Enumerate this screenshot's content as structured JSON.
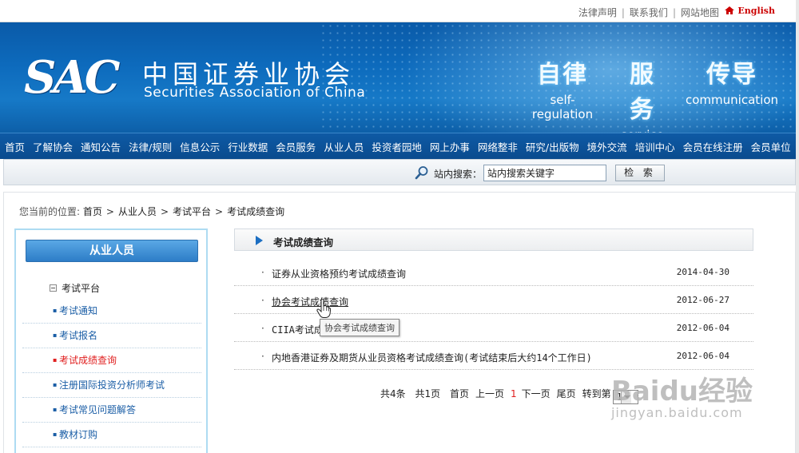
{
  "toplinks": {
    "items": [
      "法律声明",
      "联系我们",
      "网站地图"
    ],
    "english": "English"
  },
  "banner": {
    "logo_mark": "SAC",
    "name_cn": "中国证券业协会",
    "name_en": "Securities Association of China",
    "slogans": [
      {
        "cn": "自律",
        "en": "self-regulation"
      },
      {
        "cn": "服务",
        "en": "service"
      },
      {
        "cn": "传导",
        "en": "communication"
      }
    ]
  },
  "nav": {
    "items": [
      "首页",
      "了解协会",
      "通知公告",
      "法律/规则",
      "信息公示",
      "行业数据",
      "会员服务",
      "从业人员",
      "投资者园地",
      "网上办事",
      "网络整非",
      "研究/出版物",
      "境外交流",
      "培训中心",
      "会员在线注册",
      "会员单位"
    ]
  },
  "search": {
    "label": "站内搜索：",
    "value": "站内搜索关键字",
    "button": "检 索"
  },
  "breadcrumb": {
    "prefix": "您当前的位置:",
    "items": [
      "首页",
      "从业人员",
      "考试平台",
      "考试成绩查询"
    ],
    "arrow": ">"
  },
  "sidebar": {
    "heading": "从业人员",
    "group": "考试平台",
    "items": [
      {
        "label": "考试通知",
        "active": false
      },
      {
        "label": "考试报名",
        "active": false
      },
      {
        "label": "考试成绩查询",
        "active": true
      },
      {
        "label": "注册国际投资分析师考试",
        "active": false
      },
      {
        "label": "考试常见问题解答",
        "active": false
      },
      {
        "label": "教材订购",
        "active": false
      }
    ]
  },
  "main": {
    "title": "考试成绩查询",
    "news": [
      {
        "title": "证券从业资格预约考试成绩查询",
        "date": "2014-04-30"
      },
      {
        "title": "协会考试成绩查询",
        "date": "2012-06-27"
      },
      {
        "title": "CIIA考试成",
        "date": "2012-06-04"
      },
      {
        "title": "内地香港证券及期货从业员资格考试成绩查询(考试结束后大约14个工作日)",
        "date": "2012-06-04"
      }
    ],
    "tooltip": "协会考试成绩查询"
  },
  "pager": {
    "total": "共4条",
    "pages": "共1页",
    "first": "首页",
    "prev": "上一页",
    "current": "1",
    "next": "下一页",
    "last": "尾页",
    "goto": "转到第",
    "selected": "1"
  },
  "watermark": {
    "brand": "Baidu经验",
    "url": "jingyan.baidu.com"
  },
  "colors": {
    "banner_blue": "#0d6bbd",
    "nav_blue": "#0a4b8e",
    "link_blue": "#1b5ea6",
    "active_red": "#e02020"
  }
}
